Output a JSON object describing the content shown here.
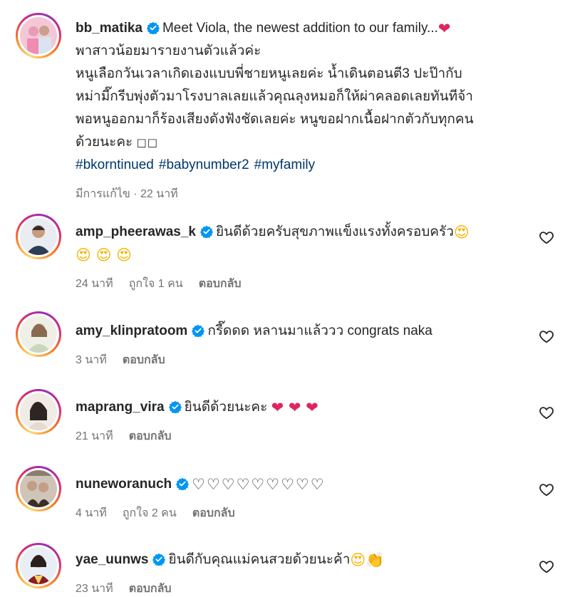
{
  "post": {
    "username": "bb_matika",
    "caption_first": "Meet Viola, the newest addition to our family...",
    "caption_first_emoji": "❤",
    "caption_lines": [
      "พาสาวน้อยมารายงานตัวแล้วค่ะ",
      "หนูเลือกวันเวลาเกิดเองแบบพี่ชายหนูเลยค่ะ น้ำเดินตอนตี3 ปะป๊ากับ",
      "หม่ามี๊กรีบพุ่งตัวมาโรงบาลเลยแล้วคุณลุงหมอก็ให้ผ่าคลอดเลยทันทีจ้า",
      "พอหนูออกมาก็ร้องเสียงดังฟังชัดเลยค่ะ หนูขอฝากเนื้อฝากตัวกับทุกคน",
      "ด้วยนะคะ"
    ],
    "caption_tail_boxes": "□□",
    "hashtags": [
      "#bkorntinued",
      "#babynumber2",
      "#myfamily"
    ],
    "edited_label": "มีการแก้ไข",
    "time": "22 นาที"
  },
  "comments": [
    {
      "username": "amp_pheerawas_k",
      "text": "ยินดีด้วยครับสุขภาพแข็งแรงทั้งครอบครัว",
      "emoji_trail": "😍",
      "line2": "😍 😍 😍",
      "time": "24 นาที",
      "likes": "ถูกใจ 1 คน",
      "reply": "ตอบกลับ"
    },
    {
      "username": "amy_klinpratoom",
      "text": "กรี๊ดดด หลานมาแล้ววว congrats naka",
      "time": "3 นาที",
      "reply": "ตอบกลับ"
    },
    {
      "username": "maprang_vira",
      "text": "ยินดีด้วยนะคะ",
      "emoji_trail": "❤ ❤ ❤",
      "time": "21 นาที",
      "reply": "ตอบกลับ"
    },
    {
      "username": "nuneworanuch",
      "text": "",
      "emoji_trail": "♡♡♡♡♡♡♡♡♡",
      "time": "4 นาที",
      "likes": "ถูกใจ 2 คน",
      "reply": "ตอบกลับ"
    },
    {
      "username": "yae_uunws",
      "text": "ยินดีกับคุณแม่คนสวยด้วยนะค้า",
      "emoji_trail": "😍",
      "emoji_trail2": "👏",
      "time": "23 นาที",
      "reply": "ตอบกลับ"
    }
  ],
  "icons": {
    "verified": "verified-badge-icon",
    "like": "heart-outline-icon"
  },
  "colors": {
    "verified_blue": "#0095f6",
    "hashtag": "#00376b",
    "meta_gray": "#737373",
    "text": "#262626"
  }
}
